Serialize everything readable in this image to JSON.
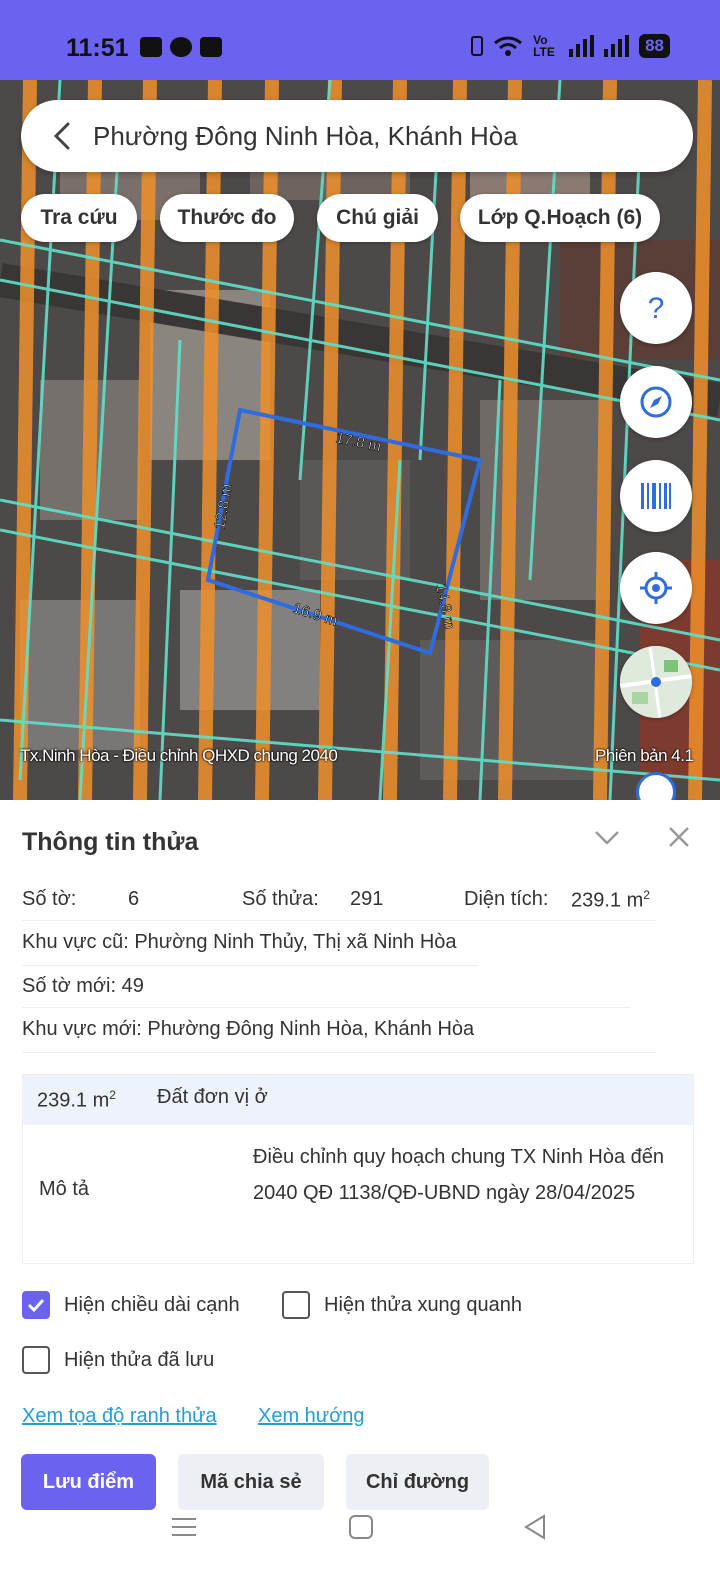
{
  "status_bar": {
    "time": "11:51",
    "network": "Vo LTE",
    "battery": "88"
  },
  "search": {
    "text": "Phường Đông Ninh Hòa, Khánh Hòa"
  },
  "chips": [
    "Tra cứu",
    "Thước đo",
    "Chú giải",
    "Lớp Q.Hoạch (6)"
  ],
  "fabs": [
    "help-icon",
    "compass-icon",
    "barcode-icon",
    "locate-icon",
    "minimap-icon"
  ],
  "map": {
    "plan_label": "Tx.Ninh Hòa - Điều chỉnh QHXD chung 2040",
    "version_label": "Phiên bản 4.1",
    "edge_top": "17.8 m",
    "edge_left": "12.8 m",
    "edge_right": "14.8 m",
    "edge_bottom": "16.9 m"
  },
  "panel": {
    "title": "Thông tin thửa",
    "so_to_label": "Số tờ:",
    "so_to_value": "6",
    "so_thua_label": "Số thửa:",
    "so_thua_value": "291",
    "dien_tich_label": "Diện tích:",
    "dien_tich_value": "239.1 m",
    "area_unit_sup": "2",
    "khu_vuc_cu": "Khu vực cũ: Phường Ninh Thủy, Thị xã Ninh Hòa",
    "so_to_moi": "Số tờ mới:  49",
    "khu_vuc_moi": "Khu vực mới: Phường Đông Ninh Hòa, Khánh Hòa",
    "card": {
      "area": "239.1 m",
      "area_sup": "2",
      "land_type": "Đất đơn vị ở",
      "desc_label": "Mô tả",
      "desc_text": "Điều chỉnh quy hoạch chung TX Ninh Hòa đến 2040 QĐ 1138/QĐ-UBND ngày 28/04/2025"
    },
    "checkboxes": [
      {
        "label": "Hiện chiều dài cạnh",
        "checked": true
      },
      {
        "label": "Hiện thửa xung quanh",
        "checked": false
      },
      {
        "label": "Hiện thửa đã lưu",
        "checked": false
      }
    ],
    "links": [
      "Xem tọa độ ranh thửa",
      "Xem hướng"
    ],
    "buttons": {
      "save": "Lưu điểm",
      "share": "Mã chia sẻ",
      "directions": "Chỉ đường"
    }
  },
  "colors": {
    "accent": "#6b63f0",
    "parcel_line": "#2f6ce0",
    "zoning_orange": "#f0902a",
    "zoning_cyan": "#5fe0c8"
  }
}
